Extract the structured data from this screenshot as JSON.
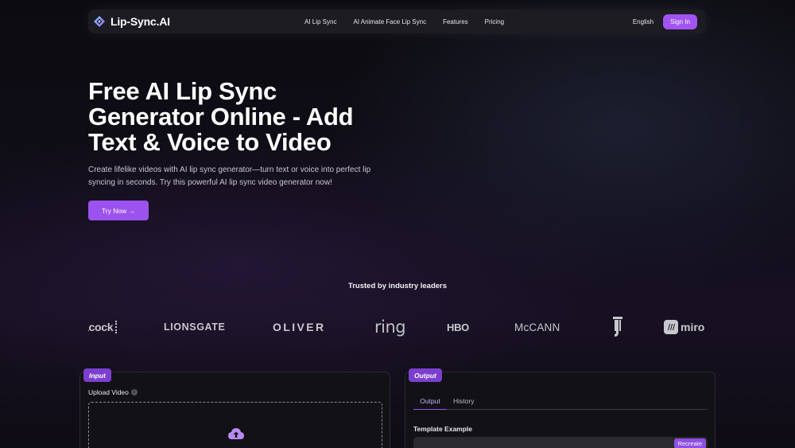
{
  "nav": {
    "brand": "Lip-Sync.AI",
    "links": [
      "AI Lip Sync",
      "AI Animate Face Lip Sync",
      "Features",
      "Pricing"
    ],
    "language": "English",
    "sign_in": "Sign In"
  },
  "hero": {
    "title_lines": [
      "Free AI Lip Sync",
      "Generator Online - Add",
      "Text & Voice to Video"
    ],
    "subtitle_lines": [
      "Create lifelike videos with AI lip sync generator—turn text or voice into perfect lip",
      "syncing in seconds. Try this powerful AI lip sync video generator now!"
    ],
    "cta": "Try Now →"
  },
  "trusted": {
    "heading": "Trusted by industry leaders",
    "logos": [
      "acock",
      "LIONSGATE",
      "OLIVER",
      "ring",
      "HBO",
      "McCANN",
      "Juventus",
      "miro"
    ]
  },
  "input_panel": {
    "tag": "Input",
    "upload_label": "Upload Video"
  },
  "output_panel": {
    "tag": "Output",
    "tabs": [
      "Output",
      "History"
    ],
    "template_label": "Template Example",
    "recreate": "Recreate"
  },
  "colors": {
    "accent": "#a154f2",
    "button": "#9c52ee",
    "tag": "#7b3fd0"
  }
}
